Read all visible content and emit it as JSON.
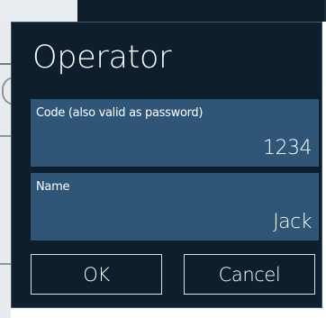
{
  "dialog": {
    "title": "Operator",
    "code_field": {
      "label": "Code (also valid as password)",
      "value": "1234"
    },
    "name_field": {
      "label": "Name",
      "value": "Jack"
    },
    "ok_label": "OK",
    "cancel_label": "Cancel"
  },
  "colors": {
    "dialog_background": "#0f1e2d",
    "field_background": "#2f5577",
    "text": "#ffffff",
    "button_border": "#d8dee4"
  }
}
